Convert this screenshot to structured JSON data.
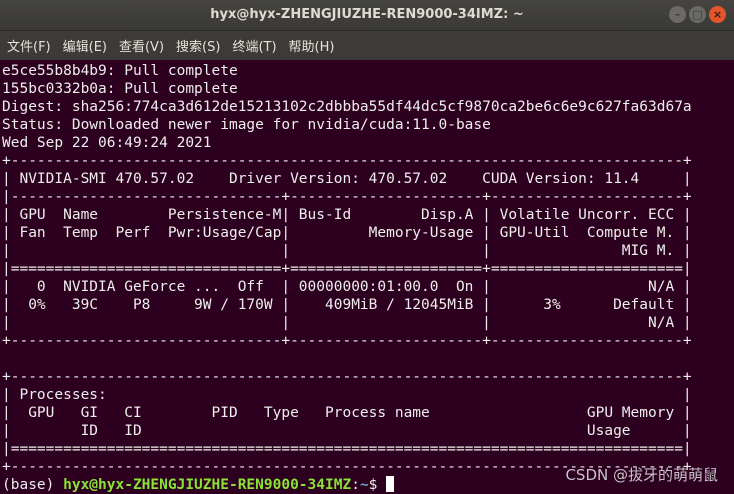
{
  "window": {
    "title": "hyx@hyx-ZHENGJIUZHE-REN9000-34IMZ: ~",
    "buttons": {
      "minimize": "–",
      "maximize": "□",
      "close": "×"
    }
  },
  "menu": [
    {
      "label": "文件(F)"
    },
    {
      "label": "编辑(E)"
    },
    {
      "label": "查看(V)"
    },
    {
      "label": "搜索(S)"
    },
    {
      "label": "终端(T)"
    },
    {
      "label": "帮助(H)"
    }
  ],
  "terminal": {
    "lines": [
      "e5ce55b8b4b9: Pull complete",
      "155bc0332b0a: Pull complete",
      "Digest: sha256:774ca3d612de15213102c2dbbba55df44dc5cf9870ca2be6c6e9c627fa63d67a",
      "Status: Downloaded newer image for nvidia/cuda:11.0-base",
      "Wed Sep 22 06:49:24 2021",
      "+-----------------------------------------------------------------------------+",
      "| NVIDIA-SMI 470.57.02    Driver Version: 470.57.02    CUDA Version: 11.4     |",
      "|-------------------------------+----------------------+----------------------+",
      "| GPU  Name        Persistence-M| Bus-Id        Disp.A | Volatile Uncorr. ECC |",
      "| Fan  Temp  Perf  Pwr:Usage/Cap|         Memory-Usage | GPU-Util  Compute M. |",
      "|                               |                      |               MIG M. |",
      "|===============================+======================+======================|",
      "|   0  NVIDIA GeForce ...  Off  | 00000000:01:00.0  On |                  N/A |",
      "|  0%   39C    P8     9W / 170W |    409MiB / 12045MiB |      3%      Default |",
      "|                               |                      |                  N/A |",
      "+-------------------------------+----------------------+----------------------+",
      "",
      "+-----------------------------------------------------------------------------+",
      "| Processes:                                                                  |",
      "|  GPU   GI   CI        PID   Type   Process name                  GPU Memory |",
      "|        ID   ID                                                   Usage      |",
      "|=============================================================================|",
      "+-----------------------------------------------------------------------------+"
    ],
    "prompt": {
      "prefix": "(base) ",
      "user_host": "hyx@hyx-ZHENGJIUZHE-REN9000-34IMZ",
      "colon": ":",
      "path": "~",
      "symbol": "$ "
    }
  },
  "watermark": "CSDN @拔牙的萌萌鼠",
  "colors": {
    "terminal_bg": "#2c001e",
    "terminal_fg": "#eeeeec",
    "prompt_user": "#8ae234",
    "prompt_path": "#729fcf",
    "close_button": "#e2542b"
  }
}
